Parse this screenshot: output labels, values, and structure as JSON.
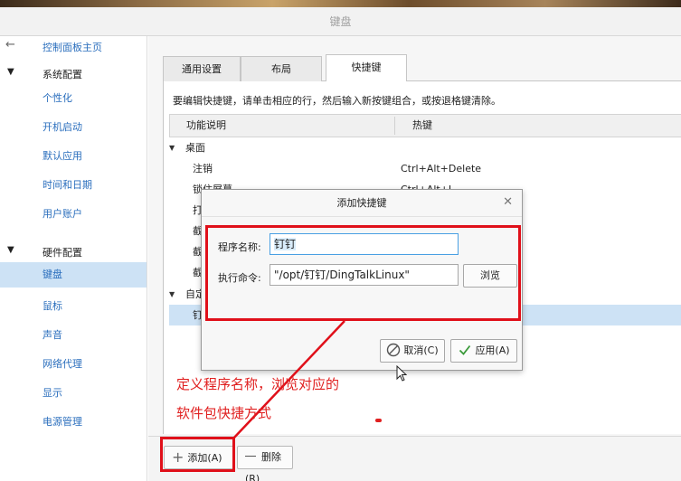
{
  "window": {
    "title": "键盘"
  },
  "sidebar": {
    "back_label": "控制面板主页",
    "groups": [
      {
        "label": "系统配置",
        "items": [
          "个性化",
          "开机启动",
          "默认应用",
          "时间和日期",
          "用户账户"
        ]
      },
      {
        "label": "硬件配置",
        "items": [
          "键盘",
          "鼠标",
          "声音",
          "网络代理",
          "显示",
          "电源管理"
        ]
      }
    ],
    "active_item": "键盘"
  },
  "tabs": [
    "通用设置",
    "布局",
    "快捷键"
  ],
  "active_tab": "快捷键",
  "hint": "要编辑快捷键，请单击相应的行，然后输入新按键组合，或按退格键清除。",
  "table": {
    "headers": [
      "功能说明",
      "热键"
    ],
    "group_desktop": "桌面",
    "rows": [
      {
        "name": "注销",
        "key": "Ctrl+Alt+Delete"
      },
      {
        "name": "锁住屏幕",
        "key": "Ctrl+Alt+L"
      },
      {
        "name": "打",
        "key": ""
      },
      {
        "name": "截",
        "key": ""
      },
      {
        "name": "截",
        "key": ""
      },
      {
        "name": "截",
        "key": ""
      }
    ],
    "group_custom": "自定",
    "custom_rows": [
      {
        "name": "钉",
        "key": ""
      }
    ]
  },
  "footer": {
    "add": "添加(A)",
    "remove": "删除(R)"
  },
  "dialog": {
    "title": "添加快捷键",
    "name_label": "程序名称:",
    "name_value": "钉钉",
    "cmd_label": "执行命令:",
    "cmd_value": "\"/opt/钉钉/DingTalkLinux\"",
    "browse": "浏览",
    "cancel": "取消(C)",
    "apply": "应用(A)"
  },
  "annotation": {
    "line1": "定义程序名称，浏览对应的",
    "line2": "软件包快捷方式"
  },
  "colors": {
    "accent": "#2a6ebd",
    "selection": "#cde2f5",
    "annotation": "#e0101a"
  }
}
